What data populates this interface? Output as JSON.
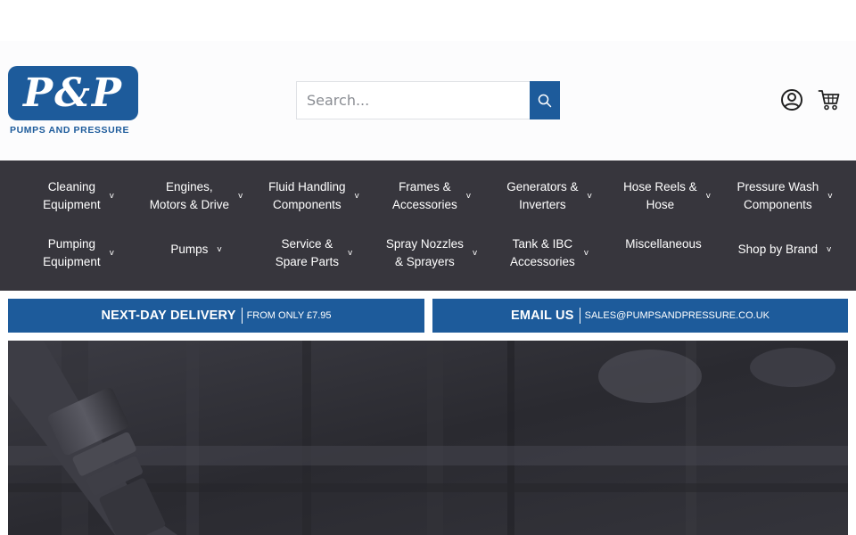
{
  "brand": {
    "mark": "P&P",
    "name": "PUMPS AND PRESSURE",
    "color": "#1d5b9b"
  },
  "search": {
    "placeholder": "Search...",
    "button_icon": "search-icon"
  },
  "header_icons": [
    "account-icon",
    "cart-icon"
  ],
  "nav": {
    "items": [
      {
        "label": "Cleaning\nEquipment",
        "has_dropdown": true
      },
      {
        "label": "Engines,\nMotors & Drive",
        "has_dropdown": true
      },
      {
        "label": "Fluid Handling\nComponents",
        "has_dropdown": true
      },
      {
        "label": "Frames &\nAccessories",
        "has_dropdown": true
      },
      {
        "label": "Generators &\nInverters",
        "has_dropdown": true
      },
      {
        "label": "Hose Reels &\nHose",
        "has_dropdown": true
      },
      {
        "label": "Pressure Wash\nComponents",
        "has_dropdown": true
      },
      {
        "label": "Pumping\nEquipment",
        "has_dropdown": true
      },
      {
        "label": "Pumps",
        "has_dropdown": true
      },
      {
        "label": "Service &\nSpare Parts",
        "has_dropdown": true
      },
      {
        "label": "Spray Nozzles\n& Sprayers",
        "has_dropdown": true
      },
      {
        "label": "Tank & IBC\nAccessories",
        "has_dropdown": true
      },
      {
        "label": "Miscellaneous",
        "has_dropdown": false
      },
      {
        "label": "Shop by Brand",
        "has_dropdown": true
      }
    ],
    "caret": "v",
    "background": "#37363d"
  },
  "banners": {
    "delivery": {
      "strong": "NEXT-DAY DELIVERY",
      "small": "FROM ONLY £7.95"
    },
    "email": {
      "strong": "EMAIL US",
      "small": "SALES@PUMPSANDPRESSURE.CO.UK"
    }
  }
}
